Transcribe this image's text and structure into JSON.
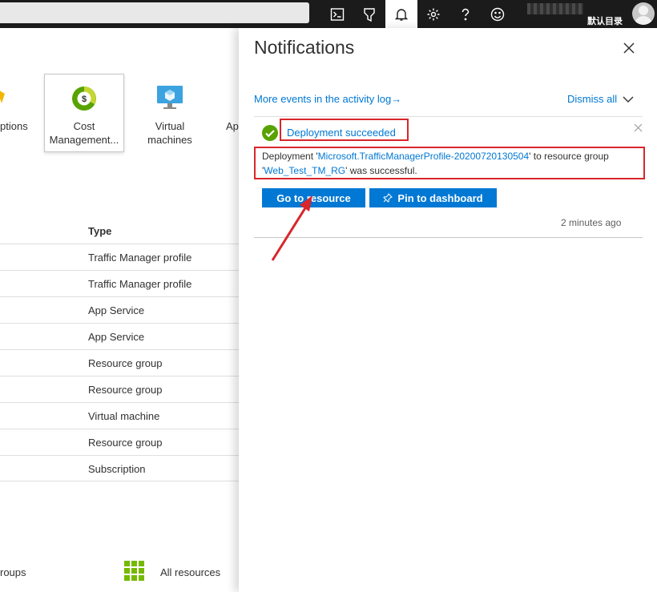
{
  "topbar": {
    "icons": [
      "cloud-shell-icon",
      "directory-filter-icon",
      "notifications-icon",
      "settings-icon",
      "help-icon",
      "feedback-icon"
    ],
    "directory_label": "默认目录"
  },
  "services": {
    "partial_left": "ptions",
    "cost_label_line1": "Cost",
    "cost_label_line2": "Management...",
    "vm_label_line1": "Virtual",
    "vm_label_line2": "machines",
    "partial_right": "Ap"
  },
  "recent": {
    "type_header": "Type",
    "rows": [
      "Traffic Manager profile",
      "Traffic Manager profile",
      "App Service",
      "App Service",
      "Resource group",
      "Resource group",
      "Virtual machine",
      "Resource group",
      "Subscription"
    ]
  },
  "bottom": {
    "left_partial": "roups",
    "all_resources": "All resources"
  },
  "notifications": {
    "title": "Notifications",
    "activity_link": "More events in the activity log",
    "activity_arrow": "→",
    "dismiss_all": "Dismiss all",
    "item": {
      "title": "Deployment succeeded",
      "desc_prefix": "Deployment '",
      "resource_name": "Microsoft.TrafficManagerProfile-20200720130504",
      "desc_middle": "' to resource group '",
      "resource_group": "Web_Test_TM_RG",
      "desc_suffix": "' was successful.",
      "go_to_resource": "Go to resource",
      "pin_to_dashboard": "Pin to dashboard",
      "time": "2 minutes ago"
    }
  },
  "colors": {
    "accent": "#0078d4",
    "success": "#57a300",
    "annotation_red": "#d9262b",
    "topbar": "#1b1b1b"
  }
}
